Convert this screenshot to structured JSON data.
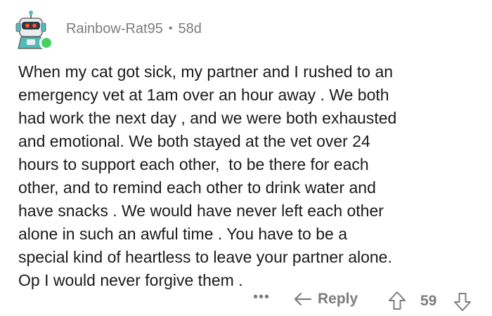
{
  "comment": {
    "author": "Rainbow-Rat95",
    "separator": "•",
    "age": "58d",
    "body_lines": [
      "When my cat got sick, my partner and I rushed to an",
      "emergency vet at 1am over an hour away . We both",
      "had work the next day , and we were both exhausted",
      "and emotional. We both stayed at the vet over 24",
      "hours to support each other,  to be there for each",
      "other, and to remind each other to drink water and",
      "have snacks . We would have never left each other",
      "alone in such an awful time . You have to be a",
      "special kind of heartless to leave your partner alone.",
      "Op I would never forgive them ."
    ]
  },
  "actions": {
    "more_label": "•••",
    "reply_label": "Reply",
    "score": "59"
  },
  "icons": {
    "avatar": "robot-avatar-icon",
    "reply": "reply-arrow-icon",
    "upvote": "upvote-arrow-icon",
    "downvote": "downvote-arrow-icon",
    "online": "online-status-dot"
  },
  "colors": {
    "text": "#1a1a1b",
    "muted": "#7c7c7c",
    "online": "#46d160",
    "avatar_bg": "#4fbdba"
  }
}
